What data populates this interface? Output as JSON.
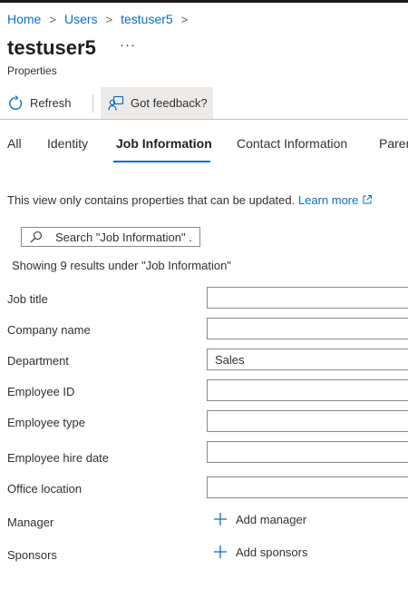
{
  "breadcrumb": {
    "items": [
      {
        "label": "Home"
      },
      {
        "label": "Users"
      },
      {
        "label": "testuser5"
      }
    ],
    "separator": ">"
  },
  "page": {
    "title": "testuser5",
    "ellipsis": "···",
    "subtitle": "Properties"
  },
  "toolbar": {
    "refresh_label": "Refresh",
    "feedback_label": "Got feedback?",
    "refresh_icon": "refresh-icon",
    "feedback_icon": "feedback-icon"
  },
  "tabs": [
    {
      "label": "All"
    },
    {
      "label": "Identity"
    },
    {
      "label": "Job Information",
      "active": true
    },
    {
      "label": "Contact Information"
    },
    {
      "label": "Parental settings"
    }
  ],
  "info": {
    "text": "This view only contains properties that can be updated.",
    "link": "Learn more"
  },
  "search": {
    "placeholder": "Search \"Job Information\" ...",
    "value": ""
  },
  "results_text": "Showing 9 results under \"Job Information\"",
  "fields": [
    {
      "label": "Job title",
      "value": ""
    },
    {
      "label": "Company name",
      "value": ""
    },
    {
      "label": "Department",
      "value": "Sales"
    },
    {
      "label": "Employee ID",
      "value": ""
    },
    {
      "label": "Employee type",
      "value": ""
    },
    {
      "label": "Employee hire date",
      "value": ""
    },
    {
      "label": "Office location",
      "value": ""
    }
  ],
  "manager": {
    "label": "Manager",
    "action": "Add manager"
  },
  "sponsors": {
    "label": "Sponsors",
    "action": "Add sponsors"
  },
  "colors": {
    "link": "#0f6cbd",
    "tab_underline": "#0f6cbd",
    "feedback_bg": "#edebe9",
    "input_border": "#8a8886"
  }
}
